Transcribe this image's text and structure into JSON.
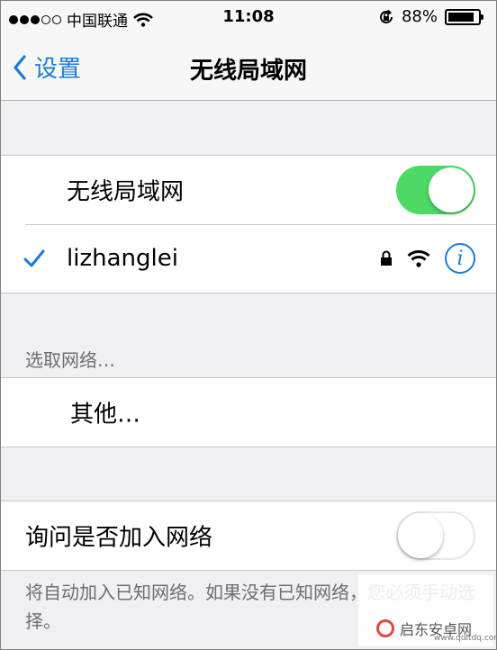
{
  "status_bar": {
    "carrier": "中国联通",
    "time": "11:08",
    "battery_text": "88%",
    "battery_level": 0.88,
    "signal_dots_filled": 3,
    "signal_dots_total": 5
  },
  "nav": {
    "back_label": "设置",
    "title": "无线局域网",
    "accent_color": "#1a7bd8"
  },
  "wifi": {
    "label": "无线局域网",
    "enabled": true,
    "connected_network": "lizhanglei",
    "info_symbol": "i",
    "icons": [
      "checkmark-icon",
      "lock-icon",
      "wifi-icon",
      "info-icon"
    ]
  },
  "choose": {
    "header": "选取网络…",
    "other_label": "其他…"
  },
  "ask": {
    "label": "询问是否加入网络",
    "enabled": false,
    "footer": "将自动加入已知网络。如果没有已知网络，您必须手动选择。"
  },
  "watermark": {
    "text": "启东安卓网",
    "url": "www.qdltdq.com"
  },
  "colors": {
    "toggle_on": "#4cd964",
    "background": "#efeff4"
  }
}
